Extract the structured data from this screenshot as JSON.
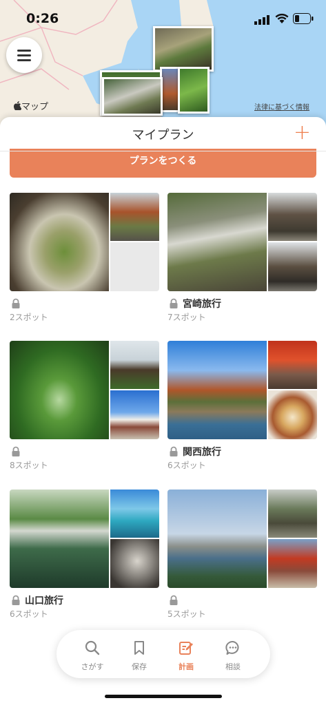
{
  "status_bar": {
    "time": "0:26"
  },
  "map": {
    "attribution": "マップ",
    "legal_link": "法律に基づく情報"
  },
  "sheet": {
    "title": "マイプラン",
    "add_symbol": "+",
    "create_button": "プランをつくる"
  },
  "plans": [
    {
      "name": "",
      "spots": "2スポット",
      "locked": true
    },
    {
      "name": "宮崎旅行",
      "spots": "7スポット",
      "locked": true
    },
    {
      "name": "",
      "spots": "8スポット",
      "locked": true
    },
    {
      "name": "関西旅行",
      "spots": "6スポット",
      "locked": true
    },
    {
      "name": "山口旅行",
      "spots": "6スポット",
      "locked": true
    },
    {
      "name": "",
      "spots": "5スポット",
      "locked": true
    }
  ],
  "tabs": [
    {
      "label": "さがす",
      "icon": "search-icon",
      "active": false
    },
    {
      "label": "保存",
      "icon": "bookmark-icon",
      "active": false
    },
    {
      "label": "計画",
      "icon": "edit-note-icon",
      "active": true
    },
    {
      "label": "相談",
      "icon": "chat-icon",
      "active": false
    }
  ],
  "colors": {
    "accent": "#e9825a",
    "map_land": "#f3ede2",
    "map_water": "#a9d5f5"
  }
}
